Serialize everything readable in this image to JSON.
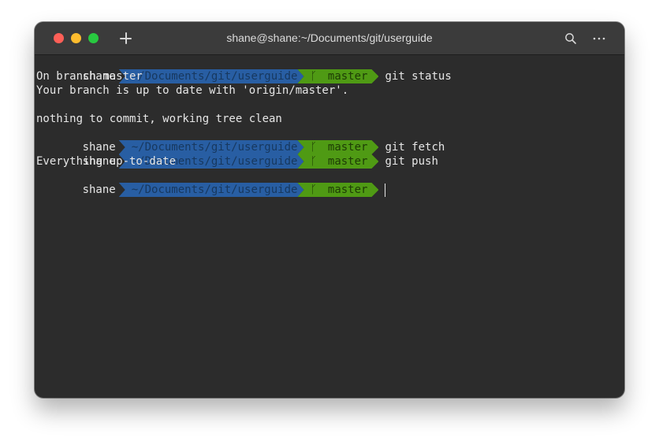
{
  "window": {
    "title": "shane@shane:~/Documents/git/userguide"
  },
  "toolbar": {
    "icons": [
      "close-button",
      "minimize-button",
      "maximize-button",
      "new-tab-plus-icon",
      "search-icon",
      "more-icon"
    ]
  },
  "colors": {
    "background": "#2c2c2c",
    "path_segment": "#285ea3",
    "git_segment": "#4f9a14",
    "text": "#e6e6e6"
  },
  "terminal": {
    "prompt": {
      "user": "shane",
      "path": "~/Documents/git/userguide",
      "branch_icon": "ᚴ",
      "branch": "master"
    },
    "commands": [
      "git status",
      "git fetch",
      "git push",
      ""
    ],
    "outputs": {
      "status": [
        "On branch master",
        "Your branch is up to date with 'origin/master'.",
        "",
        "nothing to commit, working tree clean"
      ],
      "push": [
        "Everything up-to-date"
      ]
    }
  }
}
